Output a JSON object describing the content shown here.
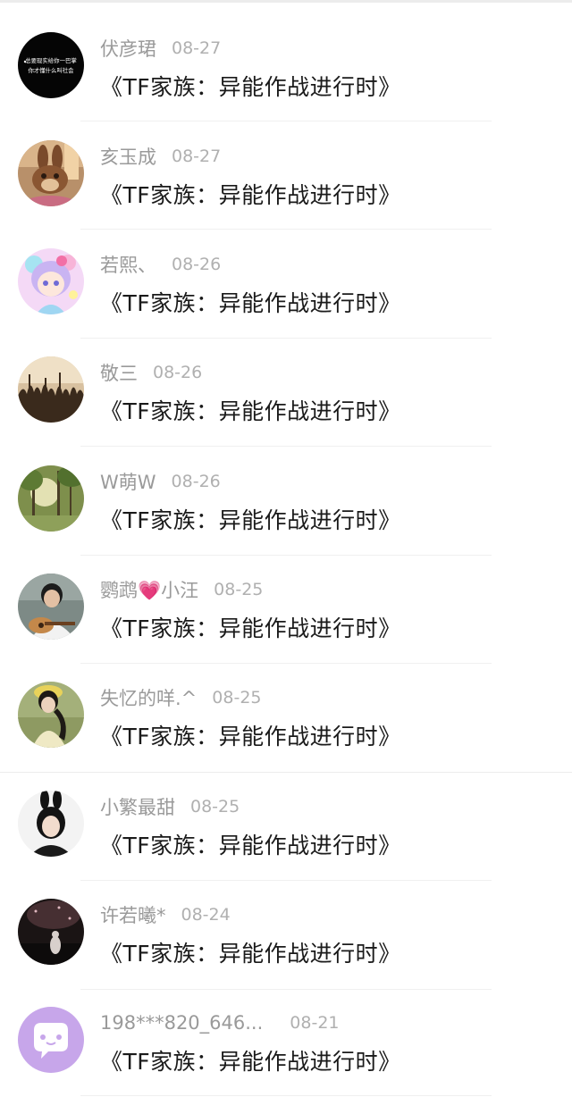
{
  "comments": [
    {
      "user": "伏彦珺",
      "date": "08-27",
      "title": "《TF家族：异能作战进行时》",
      "avatar": "text-avatar-icon"
    },
    {
      "user": "亥玉成",
      "date": "08-27",
      "title": "《TF家族：异能作战进行时》",
      "avatar": "rabbit-toy-avatar-icon"
    },
    {
      "user": "若熙、",
      "date": "08-26",
      "title": "《TF家族：异能作战进行时》",
      "avatar": "anime-girl-avatar-icon"
    },
    {
      "user": "敬三",
      "date": "08-26",
      "title": "《TF家族：异能作战进行时》",
      "avatar": "crowd-concert-avatar-icon"
    },
    {
      "user": "W萌W",
      "date": "08-26",
      "title": "《TF家族：异能作战进行时》",
      "avatar": "forest-sunlight-avatar-icon"
    },
    {
      "user": "鹦鹉💗小汪",
      "date": "08-25",
      "title": "《TF家族：异能作战进行时》",
      "avatar": "boy-guitar-avatar-icon"
    },
    {
      "user": "失忆的咩.^",
      "date": "08-25",
      "title": "《TF家族：异能作战进行时》",
      "avatar": "girl-yellow-hat-avatar-icon"
    },
    {
      "user": "小繁最甜",
      "date": "08-25",
      "title": "《TF家族：异能作战进行时》",
      "avatar": "girl-bunny-ears-avatar-icon"
    },
    {
      "user": "许若曦*",
      "date": "08-24",
      "title": "《TF家族：异能作战进行时》",
      "avatar": "night-scene-avatar-icon"
    },
    {
      "user": "198***820_646...",
      "date": "08-21",
      "title": "《TF家族：异能作战进行时》",
      "avatar": "default-chat-avatar-icon"
    }
  ],
  "avatar_text": {
    "line1": "总要现实给你一巴掌",
    "line2": "你才懂什么叫社会"
  },
  "colors": {
    "name": "#9a9a9a",
    "date": "#b0b0b0",
    "title": "#1a1a1a",
    "default_avatar_bg": "#c7a6ea"
  }
}
